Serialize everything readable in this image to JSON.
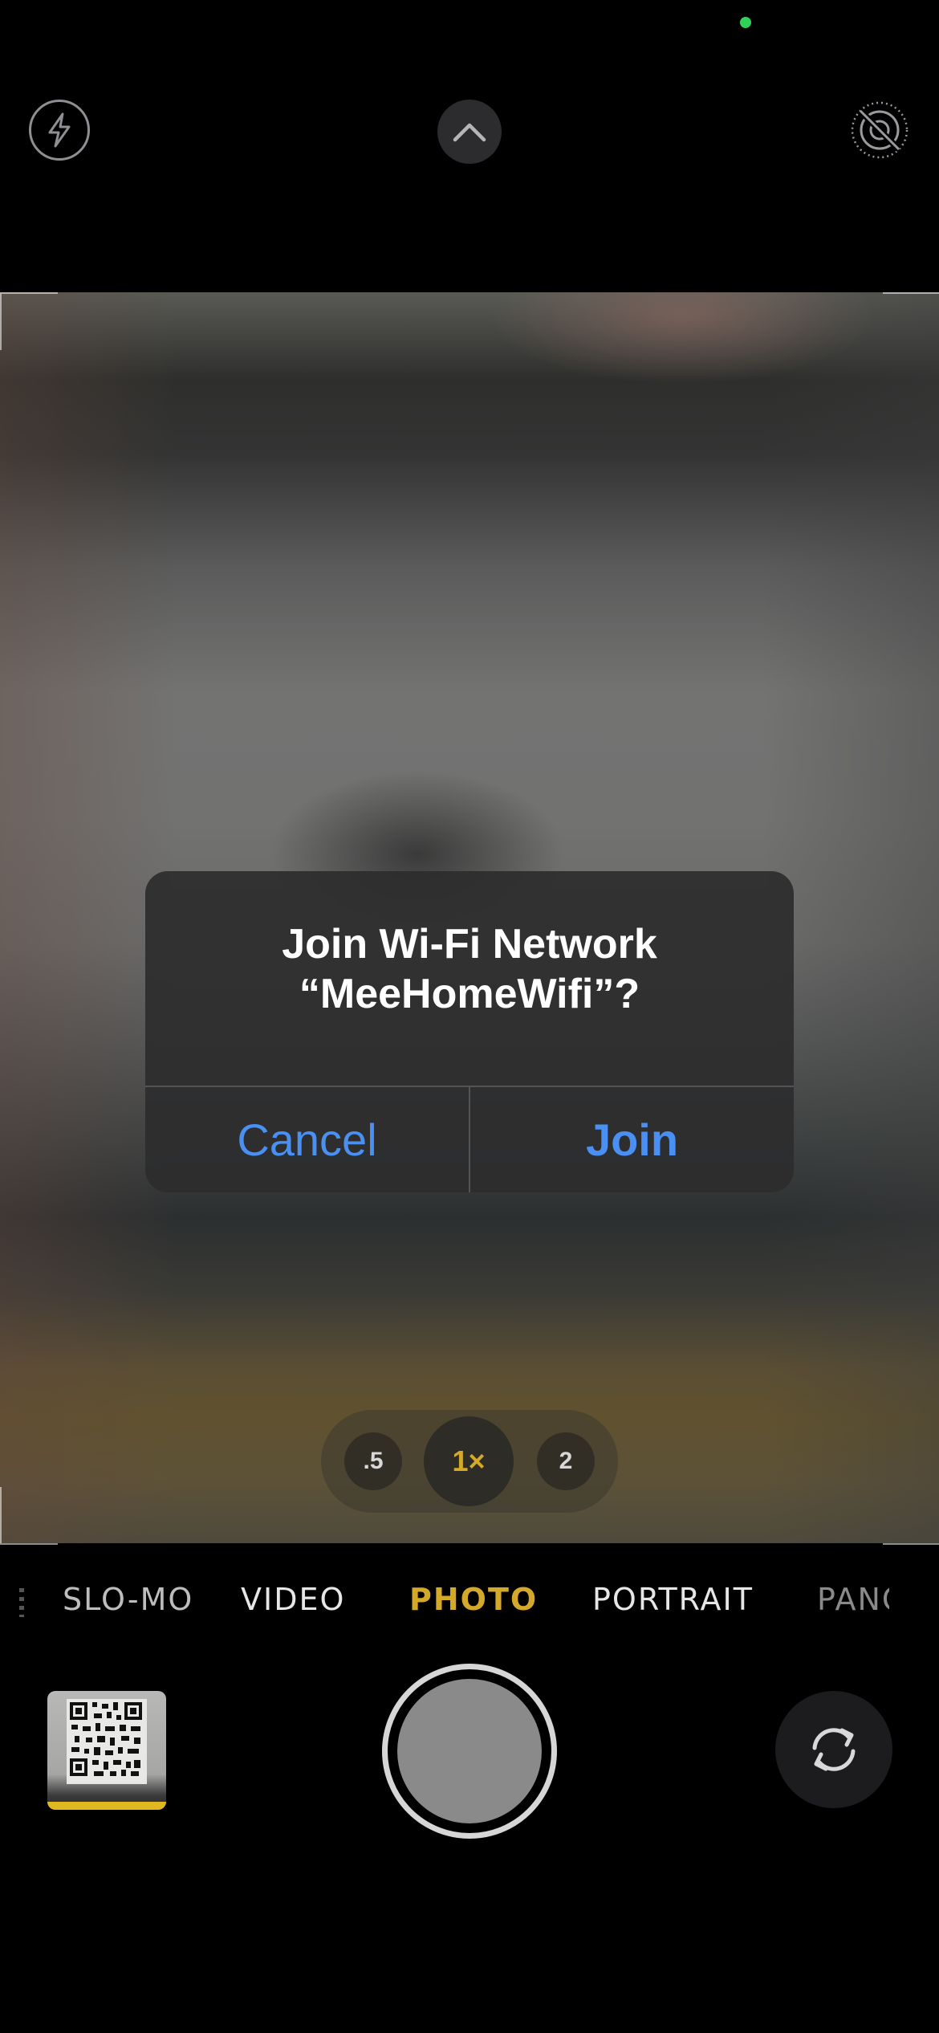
{
  "top_bar": {
    "flash_icon": "bolt-icon",
    "expand_icon": "chevron-up-icon",
    "live_photo_icon": "live-photo-off-icon"
  },
  "alert": {
    "title_line1": "Join Wi-Fi Network",
    "title_line2": "“MeeHomeWifi”?",
    "cancel_label": "Cancel",
    "join_label": "Join",
    "accent_color": "#4a8ff2"
  },
  "zoom": {
    "options": [
      ".5",
      "1×",
      "2"
    ],
    "selected": "1×",
    "selected_color": "#d4a829"
  },
  "modes": {
    "items": [
      "SLO-MO",
      "VIDEO",
      "PHOTO",
      "PORTRAIT",
      "PANO"
    ],
    "selected": "PHOTO"
  },
  "bottom": {
    "thumbnail_icon": "qr-code-photo-thumbnail",
    "shutter_icon": "shutter-button",
    "flip_icon": "camera-flip-icon"
  }
}
